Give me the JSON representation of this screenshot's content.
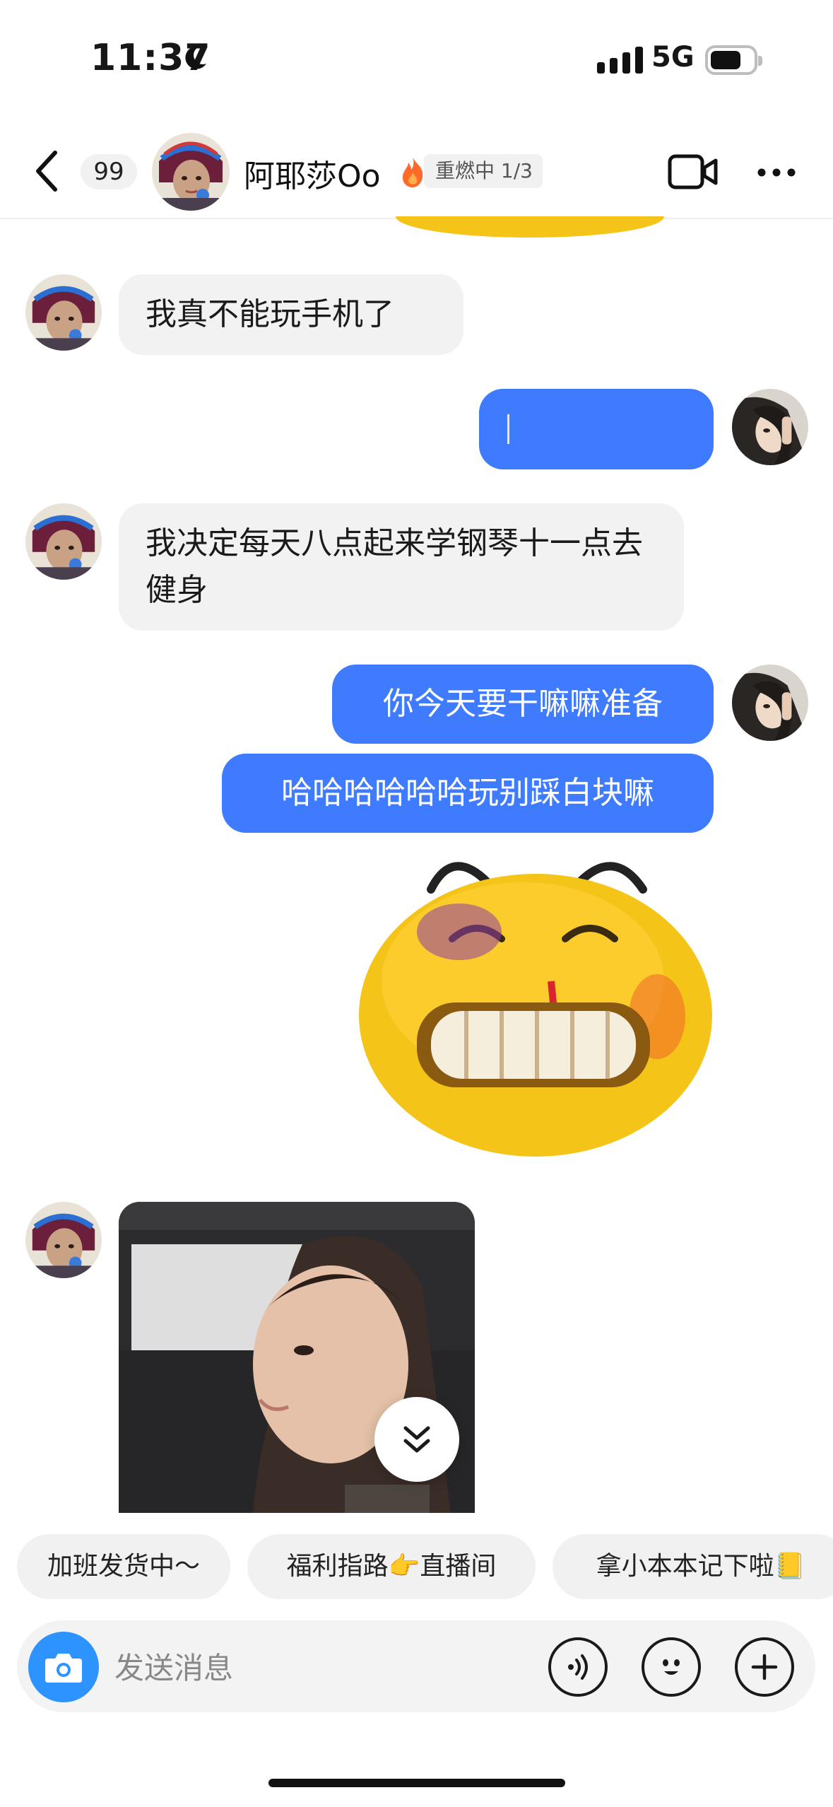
{
  "status_bar": {
    "time": "11:37",
    "network": "5G"
  },
  "header": {
    "back_label": "back",
    "unread_count": "99",
    "contact_name": "阿耶莎Oo",
    "streak_label": "重燃中 1/3"
  },
  "messages": [
    {
      "side": "in",
      "text": "我真不能玩手机了"
    },
    {
      "side": "out",
      "text": ""
    },
    {
      "side": "in",
      "text": "我决定每天八点起来学钢琴十一点去健身"
    },
    {
      "side": "out",
      "text": "你今天要干嘛嘛准备"
    },
    {
      "side": "out",
      "text": "哈哈哈哈哈哈玩别踩白块嘛"
    }
  ],
  "shortcuts": [
    {
      "label": "加班发货中～"
    },
    {
      "label": "福利指路👉直播间"
    },
    {
      "label": "拿小本本记下啦📒"
    }
  ],
  "input": {
    "placeholder": "发送消息"
  },
  "colors": {
    "accent": "#3f7bff",
    "camera": "#2d94ff",
    "streak_fire": "#ff6a2b"
  },
  "icons": [
    "back-icon",
    "fire-icon",
    "video-call-icon",
    "more-icon",
    "camera-icon",
    "voice-icon",
    "emoji-icon",
    "plus-icon",
    "double-chevron-down-icon"
  ]
}
